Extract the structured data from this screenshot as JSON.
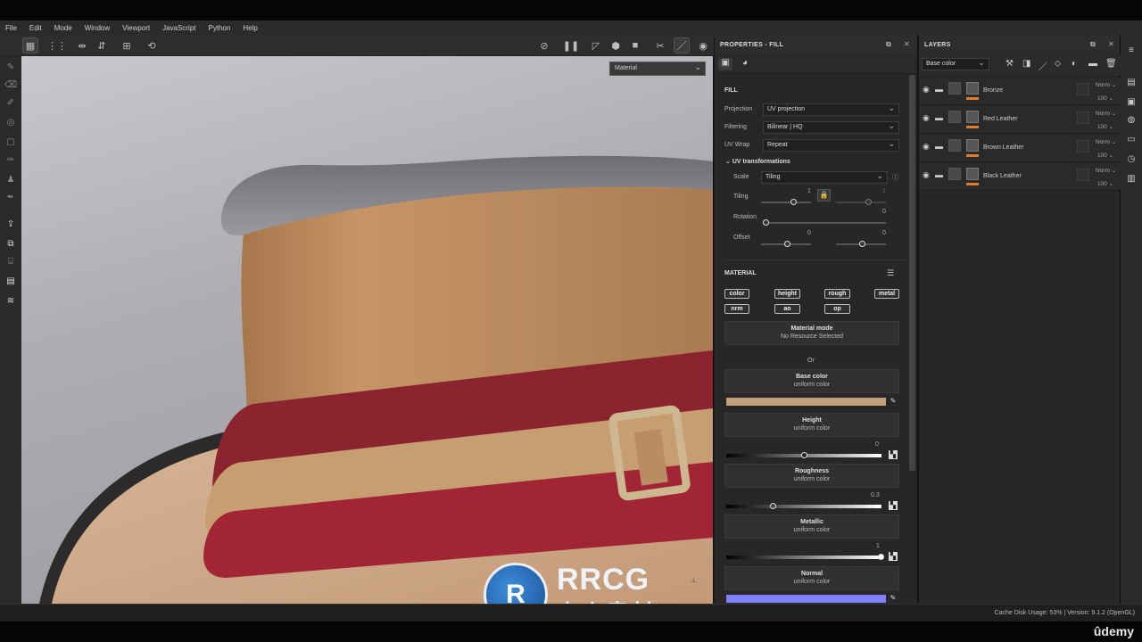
{
  "menu": [
    "File",
    "Edit",
    "Mode",
    "Window",
    "Viewport",
    "JavaScript",
    "Python",
    "Help"
  ],
  "viewport": {
    "material_dropdown": "Material"
  },
  "properties": {
    "title": "PROPERTIES - FILL",
    "fill_section": "FILL",
    "projection_label": "Projection",
    "projection_value": "UV projection",
    "filtering_label": "Filtering",
    "filtering_value": "Bilinear | HQ",
    "uvwrap_label": "UV Wrap",
    "uvwrap_value": "Repeat",
    "uv_transformations": "UV transformations",
    "scale_label": "Scale",
    "scale_value": "Tiling",
    "tiling_label": "Tiling",
    "tiling_value": "1",
    "tiling_value2": "1",
    "rotation_label": "Rotation",
    "rotation_value": "0",
    "offset_label": "Offset",
    "offset_x": "0",
    "offset_y": "0",
    "material_section": "MATERIAL",
    "channels": [
      "color",
      "height",
      "rough",
      "metal",
      "nrm",
      "ao",
      "op"
    ],
    "material_mode_title": "Material mode",
    "material_mode_sub": "No Resource Selected",
    "or_text": "Or",
    "base_color_title": "Base color",
    "base_color_sub": "uniform color",
    "base_color_hex": "#c2a07e",
    "height_title": "Height",
    "height_sub": "uniform color",
    "height_value": "0",
    "roughness_title": "Roughness",
    "roughness_sub": "uniform color",
    "roughness_value": "0.3",
    "metallic_title": "Metallic",
    "metallic_sub": "uniform color",
    "metallic_value": "1",
    "normal_title": "Normal",
    "normal_sub": "uniform color",
    "normal_hex": "#8080ff"
  },
  "layers": {
    "title": "LAYERS",
    "channel_dropdown": "Base color",
    "items": [
      {
        "name": "Bronze",
        "blend": "Norm",
        "opacity": "100"
      },
      {
        "name": "Red Leather",
        "blend": "Norm",
        "opacity": "100"
      },
      {
        "name": "Brown Leather",
        "blend": "Norm",
        "opacity": "100"
      },
      {
        "name": "Black Leather",
        "blend": "Norm",
        "opacity": "100"
      }
    ],
    "mask_accent": "#e07b2d"
  },
  "status": {
    "text": "Cache Disk Usage:   53% | Version: 9.1.2 (OpenGL)"
  },
  "watermark": {
    "line1": "RRCG",
    "line2": "人人素材"
  },
  "udemy": "ûdemy"
}
